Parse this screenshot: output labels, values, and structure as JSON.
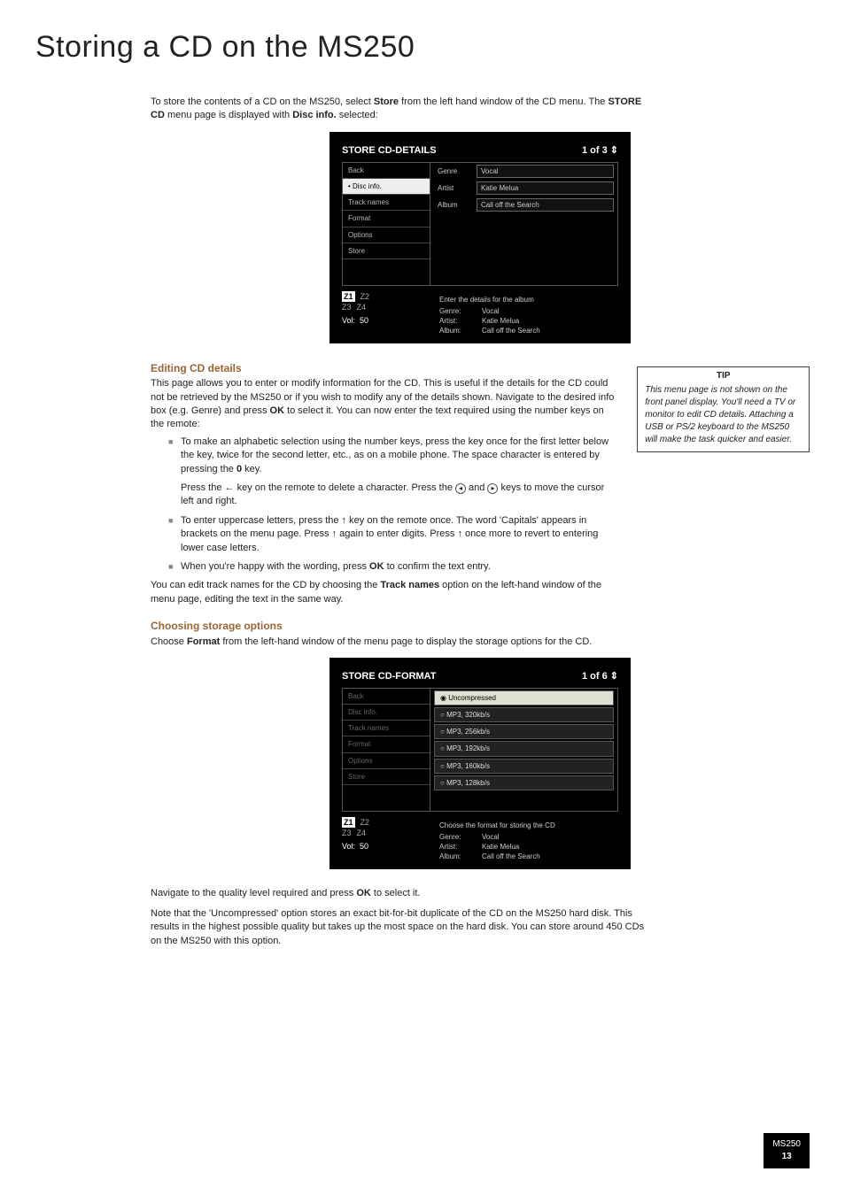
{
  "title": "Storing a CD on the MS250",
  "intro1": "To store the contents of a CD on the MS250, select ",
  "intro1b": "Store",
  "intro1c": " from the left hand window of the CD menu. The ",
  "intro1d": "STORE CD",
  "intro1e": " menu page is displayed with ",
  "intro1f": "Disc info.",
  "intro1g": " selected:",
  "scr1": {
    "heading": "STORE CD-DETAILS",
    "counter": "1 of 3 ⇕",
    "menu": [
      "Back",
      "Disc info.",
      "Track names",
      "Format",
      "Options",
      "Store"
    ],
    "selected_idx": 1,
    "fields": [
      {
        "k": "Genre",
        "v": "Vocal"
      },
      {
        "k": "Artist",
        "v": "Katie Melua"
      },
      {
        "k": "Album",
        "v": "Call off the Search"
      }
    ],
    "help": "Enter the details for the album",
    "zones": [
      "Z1",
      "Z2",
      "Z3",
      "Z4"
    ],
    "vol_label": "Vol:",
    "vol_value": "50",
    "meta": [
      {
        "k": "Genre:",
        "v": "Vocal"
      },
      {
        "k": "Artist:",
        "v": "Katie Melua"
      },
      {
        "k": "Album:",
        "v": "Call off the Search"
      }
    ]
  },
  "sec1_head": "Editing CD details",
  "sec1_para1a": "This page allows you to enter or modify information for the CD. This is useful if the details for the CD could not be retrieved by the MS250 or if you wish to modify any of the details shown. Navigate to the desired info box (e.g. Genre) and press ",
  "sec1_para1b": "OK",
  "sec1_para1c": " to select it. You can now enter the text required using the number keys on the remote:",
  "sec1_li1a": "To make an alphabetic selection using the number keys, press the key once for the first letter below the key, twice for the second letter, etc., as on a mobile phone. The space character is entered by pressing the ",
  "sec1_li1b": "0",
  "sec1_li1c": " key.",
  "sec1_li1_suba": "Press the ← key on the remote to delete a character. Press the ",
  "sec1_li1_subb": " and ",
  "sec1_li1_subc": " keys to move the cursor left and right.",
  "sec1_li2a": "To enter uppercase letters, press the ↑ key on the remote once. The word 'Capitals' appears in brackets on the menu page. Press ↑ again to enter digits. Press ↑ once more to revert to entering lower case letters.",
  "sec1_li3a": "When you're happy with the wording, press ",
  "sec1_li3b": "OK",
  "sec1_li3c": " to confirm the text entry.",
  "sec1_para2a": "You can edit track names for the CD by choosing the ",
  "sec1_para2b": "Track names",
  "sec1_para2c": " option on the left-hand window of the menu page, editing the text in the same way.",
  "tip_head": "TIP",
  "tip_body": "This menu page is not shown on the front panel display. You'll need a TV or monitor to edit CD details. Attaching a USB or PS/2 keyboard to the MS250 will make the task quicker and easier.",
  "sec2_head": "Choosing storage options",
  "sec2_para1a": "Choose ",
  "sec2_para1b": "Format",
  "sec2_para1c": " from the left-hand window of the menu page to display the storage options for the CD.",
  "scr2": {
    "heading": "STORE CD-FORMAT",
    "counter": "1 of 6 ⇕",
    "menu": [
      "Back",
      "Disc info.",
      "Track names",
      "Format",
      "Options",
      "Store"
    ],
    "selected_idx": 3,
    "options": [
      "Uncompressed",
      "MP3, 320kb/s",
      "MP3, 256kb/s",
      "MP3, 192kb/s",
      "MP3, 160kb/s",
      "MP3, 128kb/s"
    ],
    "option_sel_idx": 0,
    "help": "Choose the format for storing the CD",
    "zones": [
      "Z1",
      "Z2",
      "Z3",
      "Z4"
    ],
    "vol_label": "Vol:",
    "vol_value": "50",
    "meta": [
      {
        "k": "Genre:",
        "v": "Vocal"
      },
      {
        "k": "Artist:",
        "v": "Katie Melua"
      },
      {
        "k": "Album:",
        "v": "Call off the Search"
      }
    ]
  },
  "nav_para_a": "Navigate to the quality level required and press ",
  "nav_para_b": "OK",
  "nav_para_c": " to select it.",
  "note_para": "Note that the 'Uncompressed' option stores an exact bit-for-bit duplicate of the CD on the MS250 hard disk. This results in the highest possible quality but takes up the most space on the hard disk. You can store around 450 CDs on the MS250 with this option.",
  "page_model": "MS250",
  "page_num": "13"
}
